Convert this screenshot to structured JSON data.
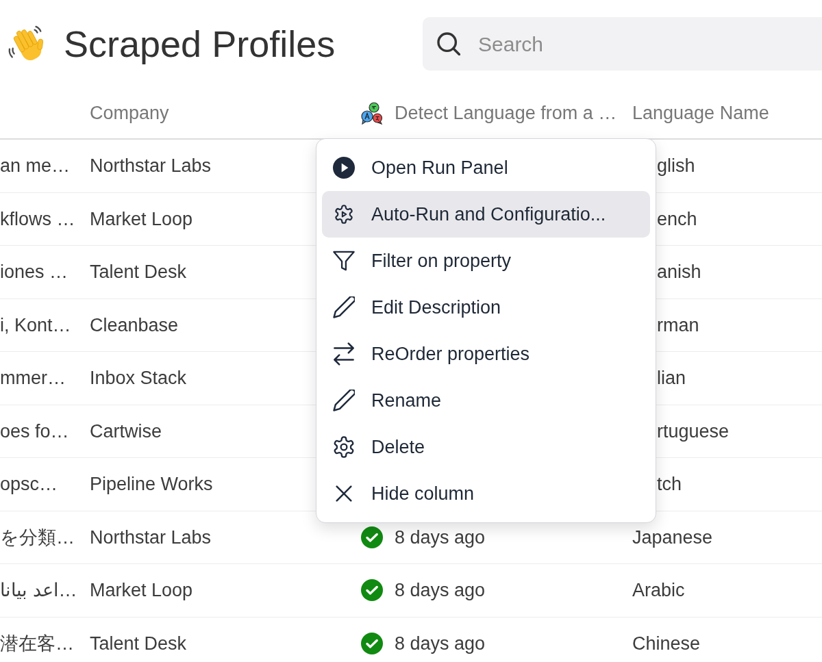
{
  "header": {
    "title": "Scraped Profiles",
    "search": {
      "placeholder": "Search"
    }
  },
  "table": {
    "columns": [
      {
        "label": "Company",
        "kind": "plain"
      },
      {
        "label": "Detect Language from a …",
        "kind": "enrichment"
      },
      {
        "label": "Language Name",
        "kind": "plain"
      }
    ],
    "rows": [
      {
        "column_1": "an me…",
        "company": "Northstar Labs",
        "language_name": "glish"
      },
      {
        "column_1": "kflows …",
        "company": "Market Loop",
        "language_name": "ench"
      },
      {
        "column_1": "iones …",
        "company": "Talent Desk",
        "language_name": "anish"
      },
      {
        "column_1": "i, Kont…",
        "company": "Cleanbase",
        "language_name": "rman"
      },
      {
        "column_1": "mmer…",
        "company": "Inbox Stack",
        "language_name": "lian"
      },
      {
        "column_1": "oes fo…",
        "company": "Cartwise",
        "language_name": "rtuguese"
      },
      {
        "column_1": "opsc…",
        "company": "Pipeline Works",
        "language_name": "tch"
      },
      {
        "column_1": "を分類…",
        "company": "Northstar Labs",
        "detect_language": {
          "complete": true,
          "text": "8 days ago"
        },
        "language_name": "Japanese"
      },
      {
        "column_1": "اعد بيانا…",
        "company": "Market Loop",
        "detect_language": {
          "complete": true,
          "text": "8 days ago"
        },
        "language_name": "Arabic"
      },
      {
        "column_1": "潜在客…",
        "company": "Talent Desk",
        "detect_language": {
          "complete": true,
          "text": "8 days ago"
        },
        "language_name": "Chinese"
      }
    ]
  },
  "context_menu": {
    "items": [
      {
        "label": "Open Run Panel",
        "kind": "run",
        "highlighted": false
      },
      {
        "label": "Auto-Run and Configuratio...",
        "kind": "autorun",
        "highlighted": true
      },
      {
        "label": "Filter on property",
        "kind": "filter",
        "highlighted": false
      },
      {
        "label": "Edit Description",
        "kind": "edit",
        "highlighted": false
      },
      {
        "label": "ReOrder properties",
        "kind": "reorder",
        "highlighted": false
      },
      {
        "label": "Rename",
        "kind": "rename",
        "highlighted": false
      },
      {
        "label": "Delete",
        "kind": "delete",
        "highlighted": false
      },
      {
        "label": "Hide column",
        "kind": "hide",
        "highlighted": false
      }
    ]
  }
}
